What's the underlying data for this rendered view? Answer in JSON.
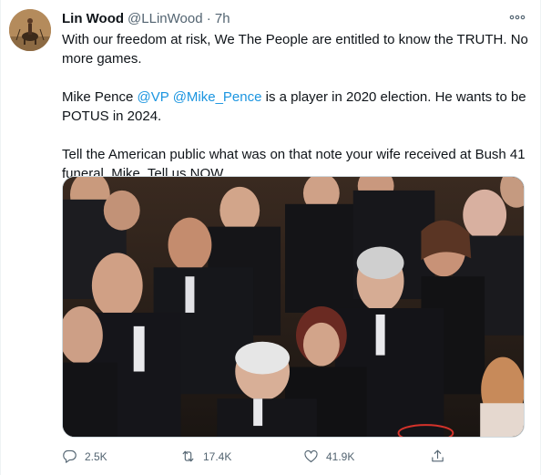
{
  "tweet": {
    "author_name": "Lin Wood",
    "author_handle": "@LLinWood",
    "time": "· 7h",
    "paragraph1": "With our freedom at risk, We The People are entitled to know the TRUTH. No more games.",
    "p2_prefix": "Mike Pence ",
    "p2_mention1": "@VP",
    "p2_space": " ",
    "p2_mention2": "@Mike_Pence",
    "p2_suffix": " is a player in 2020 election. He wants to be POTUS in 2024.",
    "paragraph3": "Tell the American public what was on that note your wife received at Bush 41 funeral, Mike. Tell us NOW."
  },
  "actions": {
    "replies": "2.5K",
    "retweets": "17.4K",
    "likes": "41.9K"
  },
  "icons": {
    "more": "more-icon",
    "reply": "reply-icon",
    "retweet": "retweet-icon",
    "like": "like-icon",
    "share": "share-icon"
  },
  "colors": {
    "link": "#1b95e0",
    "secondary_text": "#536471"
  }
}
